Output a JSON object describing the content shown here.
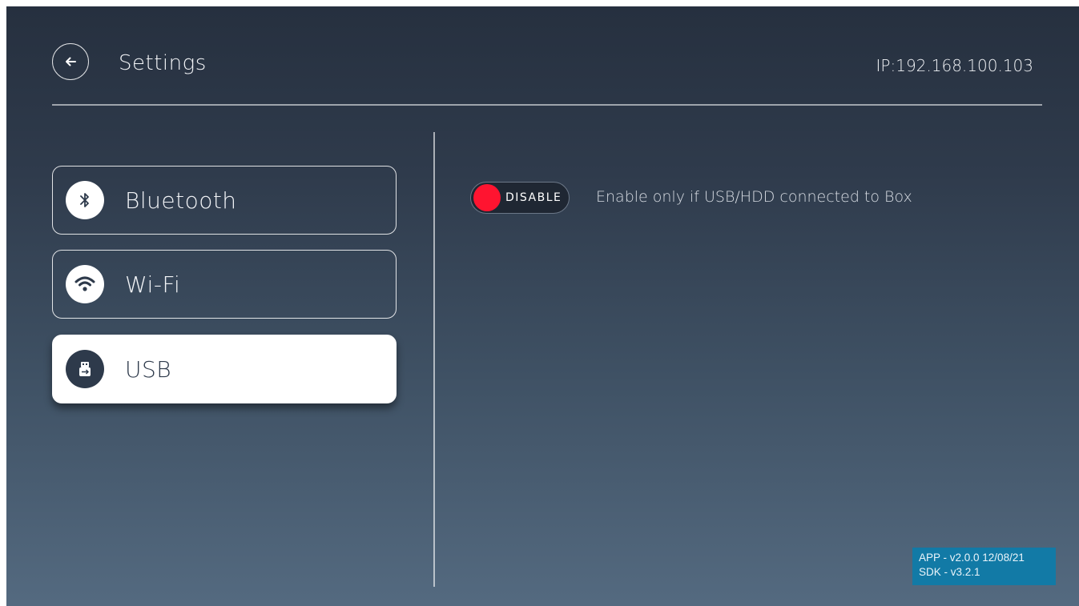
{
  "header": {
    "title": "Settings",
    "ip_text": "IP:192.168.100.103",
    "back_icon": "arrow-left-icon"
  },
  "sidebar": {
    "items": [
      {
        "label": "Bluetooth",
        "icon": "bluetooth-icon",
        "active": false
      },
      {
        "label": "Wi-Fi",
        "icon": "wifi-icon",
        "active": false
      },
      {
        "label": "USB",
        "icon": "usb-icon",
        "active": true
      }
    ]
  },
  "usb_panel": {
    "toggle_state_label": "DISABLE",
    "toggle_on": false,
    "description": "Enable only if USB/HDD connected to Box"
  },
  "version": {
    "app": "APP - v2.0.0 12/08/21",
    "sdk": "SDK - v3.2.1"
  },
  "colors": {
    "toggle_knob": "#ff1430",
    "version_badge": "#127aa6",
    "active_item_bg": "#ffffff",
    "icon_dark": "#2e3a4b"
  }
}
